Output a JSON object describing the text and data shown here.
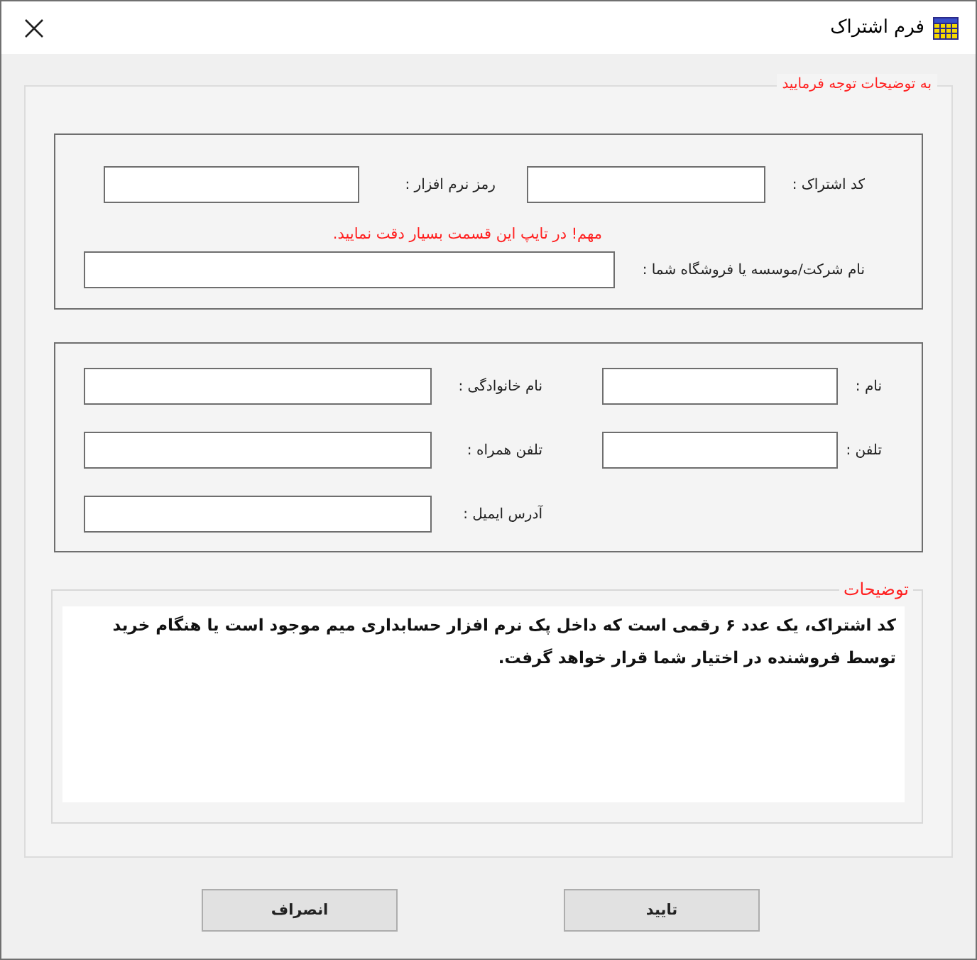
{
  "window": {
    "title": "فرم اشتراک"
  },
  "notice_group": {
    "legend": "به توضیحات توجه فرمایید"
  },
  "account_box": {
    "subscription_code_label": "کد اشتراک :",
    "software_password_label": "رمز نرم افزار :",
    "warning": "مهم! در تایپ این قسمت بسیار دقت نمایید.",
    "company_label": "نام شرکت/موسسه یا فروشگاه شما :"
  },
  "personal_box": {
    "first_name_label": "نام :",
    "last_name_label": "نام خانوادگی :",
    "phone_label": "تلفن :",
    "mobile_label": "تلفن همراه :",
    "email_label": "آدرس ایمیل :"
  },
  "description": {
    "legend": "توضیحات",
    "text": "کد اشتراک، یک عدد ۶ رقمی است که داخل پک نرم افزار حسابداری میم موجود است یا هنگام خرید توسط فروشنده در اختیار شما قرار خواهد گرفت."
  },
  "buttons": [
    "تایید",
    "انصراف"
  ]
}
